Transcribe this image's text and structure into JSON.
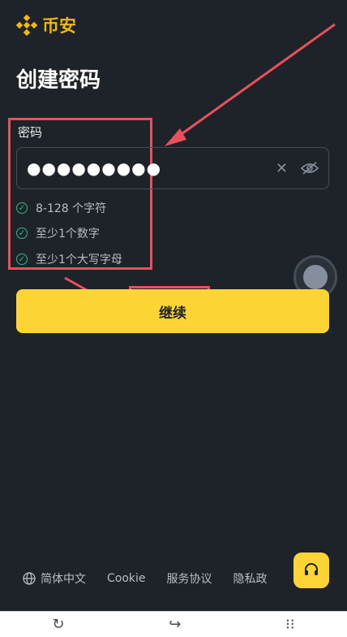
{
  "brand": {
    "name": "币安",
    "logo_icon": "binance-logo-icon",
    "color": "#f0b90b"
  },
  "page": {
    "title": "创建密码"
  },
  "password": {
    "label": "密码",
    "value": "●●●●●●●●●",
    "clear_icon": "close-icon",
    "toggle_icon": "eye-off-icon"
  },
  "rules": [
    {
      "text": "8-128 个字符",
      "met": true
    },
    {
      "text": "至少1个数字",
      "met": true
    },
    {
      "text": "至少1个大写字母",
      "met": true
    }
  ],
  "continue_button": {
    "label": "继续",
    "color": "#fcd535"
  },
  "footer": {
    "language": "简体中文",
    "links": [
      "Cookie",
      "服务协议",
      "隐私政"
    ]
  },
  "support_icon": "headset-icon",
  "bottom_bar": {
    "icons": [
      "refresh-icon",
      "share-icon",
      "more-icon"
    ]
  },
  "colors": {
    "background": "#1e2329",
    "highlight": "#e8505b",
    "success": "#2ebd85"
  }
}
